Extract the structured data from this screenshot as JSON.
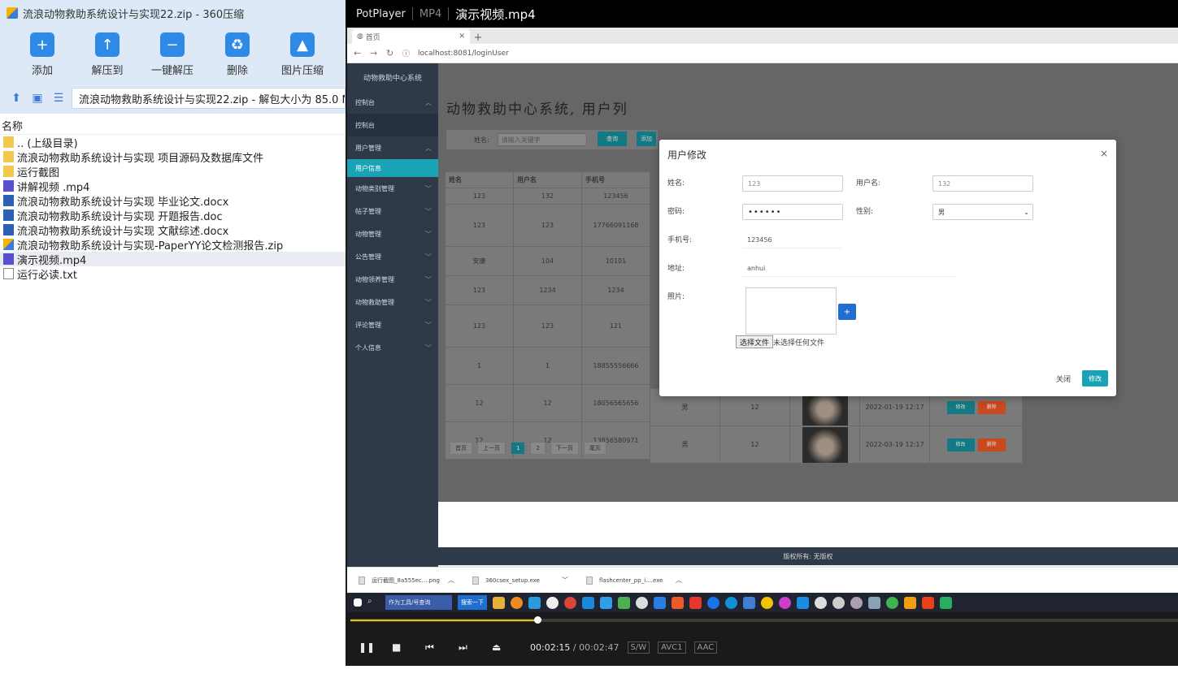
{
  "zip": {
    "title": "流浪动物救助系统设计与实现22.zip - 360压缩",
    "toolbar": [
      {
        "label": "添加",
        "icon": "add-icon"
      },
      {
        "label": "解压到",
        "icon": "extract-to-icon"
      },
      {
        "label": "一键解压",
        "icon": "one-click-extract-icon"
      },
      {
        "label": "删除",
        "icon": "delete-icon"
      },
      {
        "label": "图片压缩",
        "icon": "image-compress-icon"
      }
    ],
    "path": "流浪动物救助系统设计与实现22.zip - 解包大小为 85.0 MB",
    "column_name": "名称",
    "files": [
      {
        "name": ".. (上级目录)",
        "type": "folder"
      },
      {
        "name": "流浪动物救助系统设计与实现 项目源码及数据库文件",
        "type": "folder"
      },
      {
        "name": "运行截图",
        "type": "folder"
      },
      {
        "name": "讲解视频 .mp4",
        "type": "video"
      },
      {
        "name": "流浪动物救助系统设计与实现 毕业论文.docx",
        "type": "word"
      },
      {
        "name": "流浪动物救助系统设计与实现 开题报告.doc",
        "type": "word"
      },
      {
        "name": "流浪动物救助系统设计与实现 文献综述.docx",
        "type": "word"
      },
      {
        "name": "流浪动物救助系统设计与实现-PaperYY论文检测报告.zip",
        "type": "zip"
      },
      {
        "name": "演示视频.mp4",
        "type": "video"
      },
      {
        "name": "运行必读.txt",
        "type": "txt"
      }
    ]
  },
  "player": {
    "brand": "PotPlayer",
    "format": "MP4",
    "filename": "演示视频.mp4",
    "time_current": "00:02:15",
    "time_total": "/ 00:02:47",
    "badges": [
      "S/W",
      "AVC1",
      "AAC"
    ],
    "progress": 0.808
  },
  "browser": {
    "tab_title": "首页",
    "url": "localhost:8081/loginUser"
  },
  "webapp": {
    "system_name": "动物救助中心系统",
    "page_heading": "动物救助中心系统, 用户列",
    "menu": [
      {
        "label": "控制台",
        "chev": "︿"
      },
      {
        "label": "控制台",
        "chev": ""
      },
      {
        "label": "用户管理",
        "chev": "︿"
      },
      {
        "label": "用户信息",
        "chev": ""
      },
      {
        "label": "动物类别管理",
        "chev": "﹀"
      },
      {
        "label": "帖子管理",
        "chev": "﹀"
      },
      {
        "label": "动物管理",
        "chev": "﹀"
      },
      {
        "label": "公告管理",
        "chev": "﹀"
      },
      {
        "label": "动物领养管理",
        "chev": "﹀"
      },
      {
        "label": "动物救助管理",
        "chev": "﹀"
      },
      {
        "label": "评论管理",
        "chev": "﹀"
      },
      {
        "label": "个人信息",
        "chev": "﹀"
      }
    ],
    "search_label": "姓名:",
    "search_placeholder": "请输入关键字",
    "search_btn": "查询",
    "add_btn": "添加",
    "table_headers": [
      "姓名",
      "用户名",
      "手机号"
    ],
    "table_rows": [
      [
        "123",
        "132",
        "123456"
      ],
      [
        "123",
        "123",
        "17766091168"
      ],
      [
        "安康",
        "104",
        "10101"
      ],
      [
        "123",
        "1234",
        "1234"
      ],
      [
        "123",
        "123",
        "121"
      ],
      [
        "1",
        "1",
        "18855556666"
      ],
      [
        "12",
        "12",
        "18056565656"
      ],
      [
        "12",
        "12",
        "13856580971"
      ]
    ],
    "extra_rows": [
      {
        "gender": "男",
        "age": "12",
        "time": "2022-01-19 12:17",
        "edit": "修改",
        "del": "删除"
      },
      {
        "gender": "男",
        "age": "12",
        "time": "2022-03-19 12:17",
        "edit": "修改",
        "del": "删除"
      }
    ],
    "pager": [
      "首页",
      "上一页",
      "1",
      "2",
      "下一页",
      "尾页"
    ],
    "footer": "版权所有: 无版权"
  },
  "modal": {
    "title": "用户修改",
    "close": "×",
    "labels": {
      "name": "姓名:",
      "username": "用户名:",
      "password": "密码:",
      "gender": "性别:",
      "phone": "手机号:",
      "address": "地址:",
      "photo": "照片:"
    },
    "values": {
      "name": "123",
      "username": "132",
      "password": "••••••",
      "gender": "男",
      "phone": "123456",
      "address": "anhui"
    },
    "file_btn": "选择文件",
    "file_text": "未选择任何文件",
    "btn_close": "关闭",
    "btn_submit": "修改"
  },
  "downloads": [
    "运行截图_8a555ec....png",
    "360csex_setup.exe",
    "flashcenter_pp_i....exe"
  ],
  "taskbar": {
    "search_text": "作为工具/号查询",
    "search_btn": "搜索一下"
  }
}
